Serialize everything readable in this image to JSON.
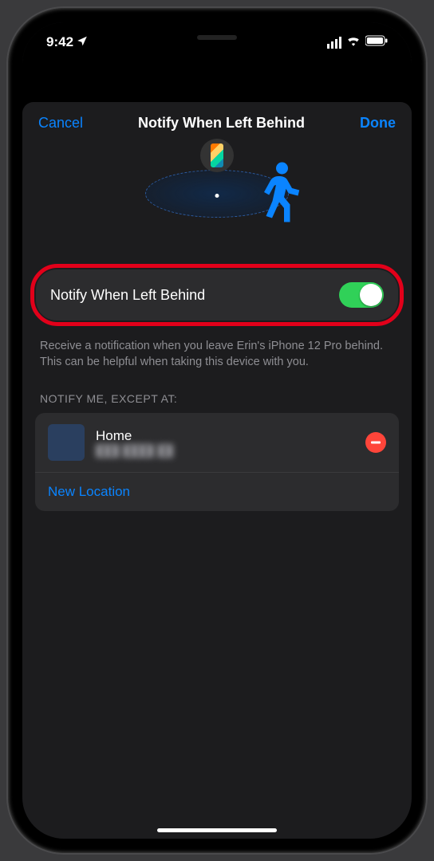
{
  "status": {
    "time": "9:42"
  },
  "nav": {
    "cancel": "Cancel",
    "title": "Notify When Left Behind",
    "done": "Done"
  },
  "toggle": {
    "label": "Notify When Left Behind",
    "on": true
  },
  "description": "Receive a notification when you leave Erin's iPhone 12 Pro behind. This can be helpful when taking this device with you.",
  "exceptHeader": "NOTIFY ME, EXCEPT AT:",
  "locations": [
    {
      "name": "Home",
      "address": "███ ████ ██"
    }
  ],
  "newLocation": "New Location"
}
